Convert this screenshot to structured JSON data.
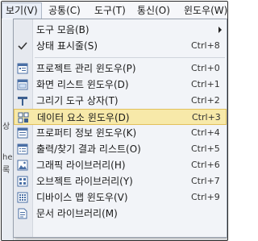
{
  "menubar": {
    "items": [
      {
        "label": "보기(V)"
      },
      {
        "label": "공통(C)"
      },
      {
        "label": "도구(T)"
      },
      {
        "label": "통신(O)"
      },
      {
        "label": "윈도우(W)"
      }
    ]
  },
  "left_strip": {
    "glyphs": [
      "상",
      "he",
      "록"
    ]
  },
  "menu": {
    "items": [
      {
        "label": "도구 모음(B)",
        "shortcut": "",
        "icon": "none",
        "submenu": true
      },
      {
        "label": "상태 표시줄(S)",
        "shortcut": "Ctrl+8",
        "icon": "check-icon"
      },
      {
        "label": "프로젝트 관리 윈도우(P)",
        "shortcut": "Ctrl+0",
        "icon": "folder-icon"
      },
      {
        "label": "화면 리스트 윈도우(D)",
        "shortcut": "Ctrl+1",
        "icon": "screen-list-icon"
      },
      {
        "label": "그리기 도구 상자(T)",
        "shortcut": "Ctrl+2",
        "icon": "drawing-tool-icon"
      },
      {
        "label": "데이터 요소 윈도우(D)",
        "shortcut": "Ctrl+3",
        "icon": "data-element-icon",
        "highlighted": true
      },
      {
        "label": "프로퍼티 정보 윈도우(K)",
        "shortcut": "Ctrl+4",
        "icon": "property-icon"
      },
      {
        "label": "출력/찾기 결과 리스트(O)",
        "shortcut": "Ctrl+5",
        "icon": "output-list-icon"
      },
      {
        "label": "그래픽 라이브러리(H)",
        "shortcut": "Ctrl+6",
        "icon": "graphic-library-icon"
      },
      {
        "label": "오브젝트 라이브러리(Y)",
        "shortcut": "Ctrl+7",
        "icon": "object-library-icon"
      },
      {
        "label": "디바이스 맵 윈도우(V)",
        "shortcut": "Ctrl+9",
        "icon": "device-map-icon"
      },
      {
        "label": "문서 라이브러리(M)",
        "shortcut": "",
        "icon": "document-library-icon"
      }
    ]
  },
  "colors": {
    "highlight_bg": "#f7e9a9",
    "highlight_border": "#e2c15c",
    "menu_bg": "#f2f4f8"
  }
}
